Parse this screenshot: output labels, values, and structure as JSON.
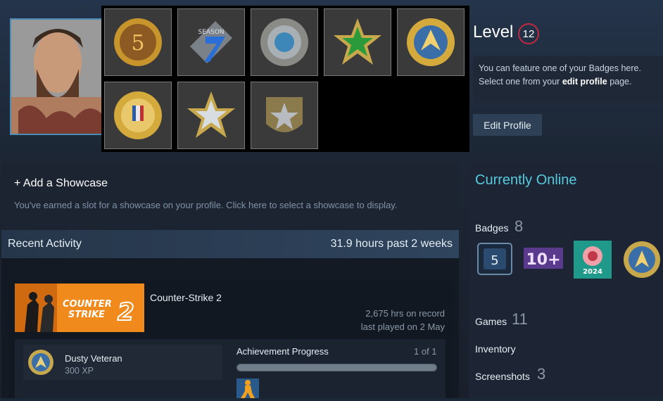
{
  "profile": {
    "level_label": "Level",
    "level_value": "12",
    "feature_text_1": "You can feature one of your Badges here.",
    "feature_text_2_prefix": "Select one from your ",
    "feature_text_2_link": "edit profile",
    "feature_text_2_suffix": " page.",
    "edit_profile_label": "Edit Profile"
  },
  "badge_popup": {
    "badges": [
      {
        "name": "5-year-veteran-coin",
        "text": "5"
      },
      {
        "name": "season-7-badge",
        "text": "SEASON"
      },
      {
        "name": "silver-operation-coin",
        "text": ""
      },
      {
        "name": "green-star-coin",
        "text": ""
      },
      {
        "name": "gold-service-medal",
        "text": ""
      },
      {
        "name": "gold-major-coin",
        "text": ""
      },
      {
        "name": "silver-star-medal",
        "text": ""
      },
      {
        "name": "army-star-shield",
        "text": ""
      }
    ]
  },
  "showcase": {
    "title": "+ Add a Showcase",
    "desc": "You've earned a slot for a showcase on your profile. Click here to select a showcase to display."
  },
  "recent_activity": {
    "title": "Recent Activity",
    "hours": "31.9 hours past 2 weeks",
    "game": {
      "logo_line1": "COUNTER",
      "logo_line2": "STRIKE",
      "logo_num": "2",
      "name": "Counter-Strike 2",
      "hrs_on_record": "2,675 hrs on record",
      "last_played": "last played on 2 May"
    },
    "achievement": {
      "name": "Dusty Veteran",
      "xp": "300 XP",
      "progress_label": "Achievement Progress",
      "progress_count": "1 of 1",
      "progress_fraction": 1.0
    }
  },
  "sidebar": {
    "status": "Currently Online",
    "badges_label": "Badges",
    "badges_count": "8",
    "badge_5_text": "5",
    "badge_10_text": "10+",
    "badge_2024_text": "2024",
    "games_label": "Games",
    "games_count": "11",
    "inventory_label": "Inventory",
    "screenshots_label": "Screenshots",
    "screenshots_count": "3"
  },
  "colors": {
    "accent_online": "#57cbde",
    "level_ring": "#c02942",
    "cs_orange": "#f08a1c"
  }
}
